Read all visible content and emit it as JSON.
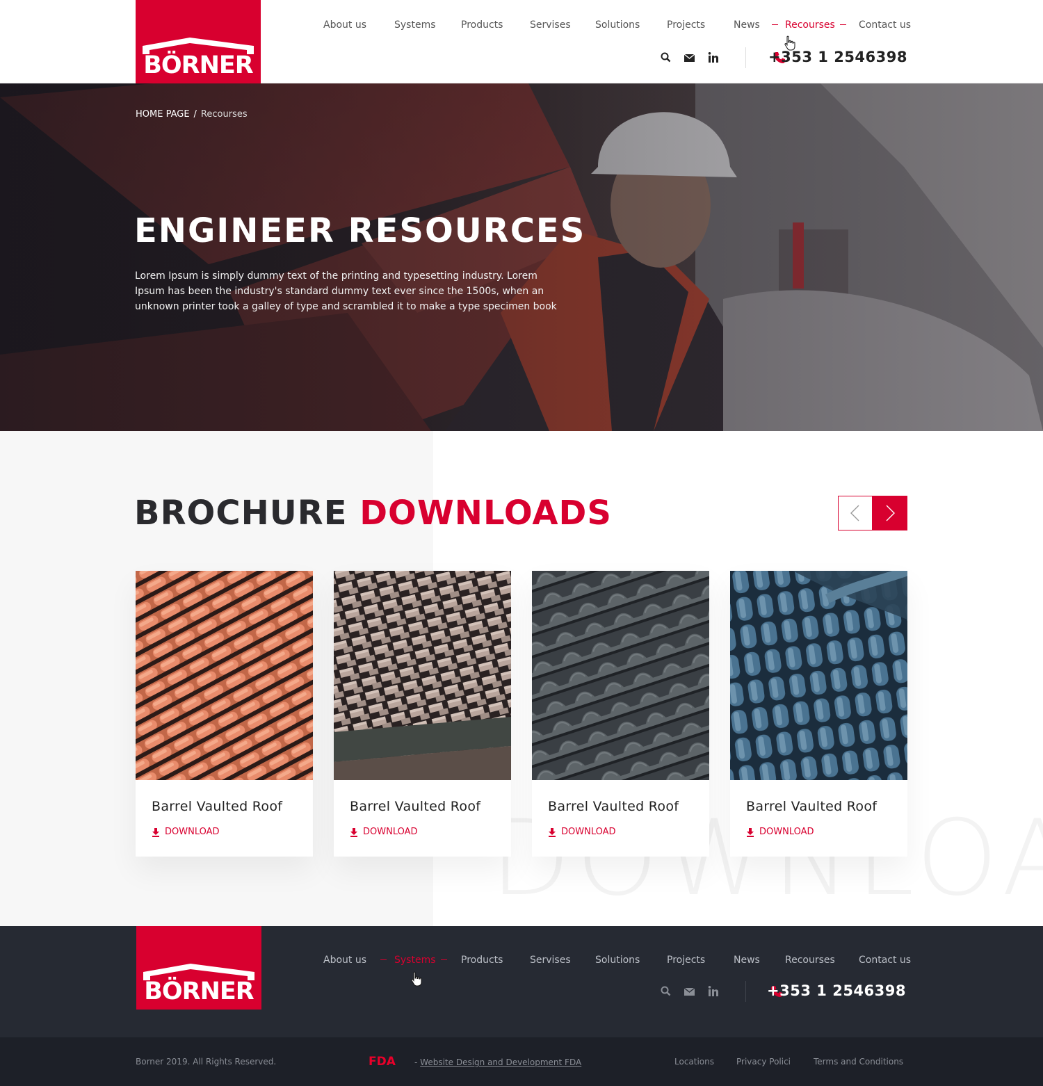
{
  "brand": {
    "name": "BÖRNER",
    "color": "#d8002f"
  },
  "header": {
    "nav": [
      {
        "label": "About us"
      },
      {
        "label": "Systems"
      },
      {
        "label": "Products"
      },
      {
        "label": "Servises"
      },
      {
        "label": "Solutions"
      },
      {
        "label": "Projects"
      },
      {
        "label": "News"
      },
      {
        "label": "Recourses"
      },
      {
        "label": "Contact us"
      }
    ],
    "active_nav": "Recourses",
    "phone": "+353 1 2546398",
    "icons": [
      "search-icon",
      "mail-icon",
      "linkedin-icon",
      "phone-icon"
    ]
  },
  "hero": {
    "breadcrumb": {
      "home": "HOME PAGE",
      "separator": "/",
      "current": "Recourses"
    },
    "title": "ENGINEER RESOURCES",
    "text": "Lorem Ipsum is simply dummy text of the printing and typesetting industry. Lorem Ipsum has been the industry's standard dummy text ever since the 1500s, when an unknown printer took a galley of type and scrambled it to make a type specimen book"
  },
  "brochures": {
    "title_part1": "BROCHURE",
    "title_part2": "DOWNLOADS",
    "watermark": "DOWNLOAD",
    "items": [
      {
        "title": "Barrel Vaulted Roof",
        "action": "DOWNLOAD",
        "tile": "terracotta-tiles"
      },
      {
        "title": "Barrel Vaulted Roof",
        "action": "DOWNLOAD",
        "tile": "beige-tiles"
      },
      {
        "title": "Barrel Vaulted Roof",
        "action": "DOWNLOAD",
        "tile": "grey-tiles"
      },
      {
        "title": "Barrel Vaulted Roof",
        "action": "DOWNLOAD",
        "tile": "blue-tiles"
      }
    ]
  },
  "footer": {
    "nav": [
      {
        "label": "About us"
      },
      {
        "label": "Systems"
      },
      {
        "label": "Products"
      },
      {
        "label": "Servises"
      },
      {
        "label": "Solutions"
      },
      {
        "label": "Projects"
      },
      {
        "label": "News"
      },
      {
        "label": "Recourses"
      },
      {
        "label": "Contact us"
      }
    ],
    "active_nav": "Systems",
    "phone": "+353 1 2546398",
    "copyright": "Borner 2019. All Rights Reserved.",
    "fda_logo": "FDA",
    "fda_prefix": "-",
    "fda_link": "Website Design and Development FDA",
    "links": [
      "Locations",
      "Privacy Polici",
      "Terms and Conditions"
    ]
  }
}
